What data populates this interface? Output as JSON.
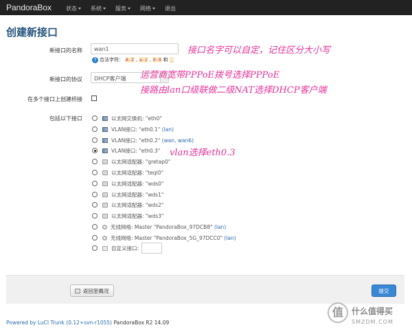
{
  "app": {
    "brand": "PandoraBox"
  },
  "nav": [
    {
      "label": "状态"
    },
    {
      "label": "系统"
    },
    {
      "label": "服务"
    },
    {
      "label": "网络"
    },
    {
      "label": "退出"
    }
  ],
  "page": {
    "title": "创建新接口"
  },
  "form": {
    "name_label": "新接口的名称",
    "name_value": "wan1",
    "hint_prefix": "合法字符：",
    "hint_codes": [
      "A-Z",
      "a-z",
      "0-9"
    ],
    "hint_and": "和",
    "hint_last": "_",
    "proto_label": "新接口的协议",
    "proto_value": "DHCP客户端",
    "bridge_label": "在多个接口上创建桥接",
    "cover_label": "包括以下接口",
    "interfaces": [
      {
        "type": "switch",
        "text": "以太网交换机: \"eth0\"",
        "extra": "",
        "selected": false
      },
      {
        "type": "switch",
        "text": "VLAN接口: \"eth0.1\"",
        "extra": "(lan)",
        "selected": false
      },
      {
        "type": "switch",
        "text": "VLAN接口: \"eth0.2\"",
        "extra": "(wan, wan6)",
        "selected": false
      },
      {
        "type": "switch",
        "text": "VLAN接口: \"eth0.3\"",
        "extra": "",
        "selected": true
      },
      {
        "type": "eth",
        "text": "以太网适配器: \"gretap0\"",
        "extra": "",
        "selected": false
      },
      {
        "type": "eth",
        "text": "以太网适配器: \"teql0\"",
        "extra": "",
        "selected": false
      },
      {
        "type": "eth",
        "text": "以太网适配器: \"wds0\"",
        "extra": "",
        "selected": false
      },
      {
        "type": "eth",
        "text": "以太网适配器: \"wds1\"",
        "extra": "",
        "selected": false
      },
      {
        "type": "eth",
        "text": "以太网适配器: \"wds2\"",
        "extra": "",
        "selected": false
      },
      {
        "type": "eth",
        "text": "以太网适配器: \"wds3\"",
        "extra": "",
        "selected": false
      },
      {
        "type": "wifi",
        "text": "无线网络: Master \"PandoraBox_97DCB8\"",
        "extra": "(lan)",
        "selected": false
      },
      {
        "type": "wifi",
        "text": "无线网络: Master \"PandoraBox_5G_97DCC0\"",
        "extra": "(lan)",
        "selected": false
      },
      {
        "type": "custom",
        "text": "自定义接口:",
        "extra": "",
        "selected": false
      }
    ]
  },
  "actions": {
    "back_label": "返回至概况",
    "submit_label": "提交"
  },
  "footer": {
    "powered_link": "Powered by LuCI Trunk (0.12+svn-r1055)",
    "version": "PandoraBox R2 14.09"
  },
  "annotations": {
    "a1": "接口名字可以自定，记住区分大小写",
    "a2": "运营商宽带PPPoE拨号选择PPPoE",
    "a3": "接路由lan口级联做二级NAT选择DHCP客户端",
    "a4": "vlan选择eth0.3"
  },
  "watermark": {
    "logo": "值",
    "line1": "什么值得买",
    "line2": "SMZDM.COM"
  },
  "colors": {
    "title": "#23527c",
    "annotation": "#e8309a",
    "submit": "#3a87d4"
  }
}
